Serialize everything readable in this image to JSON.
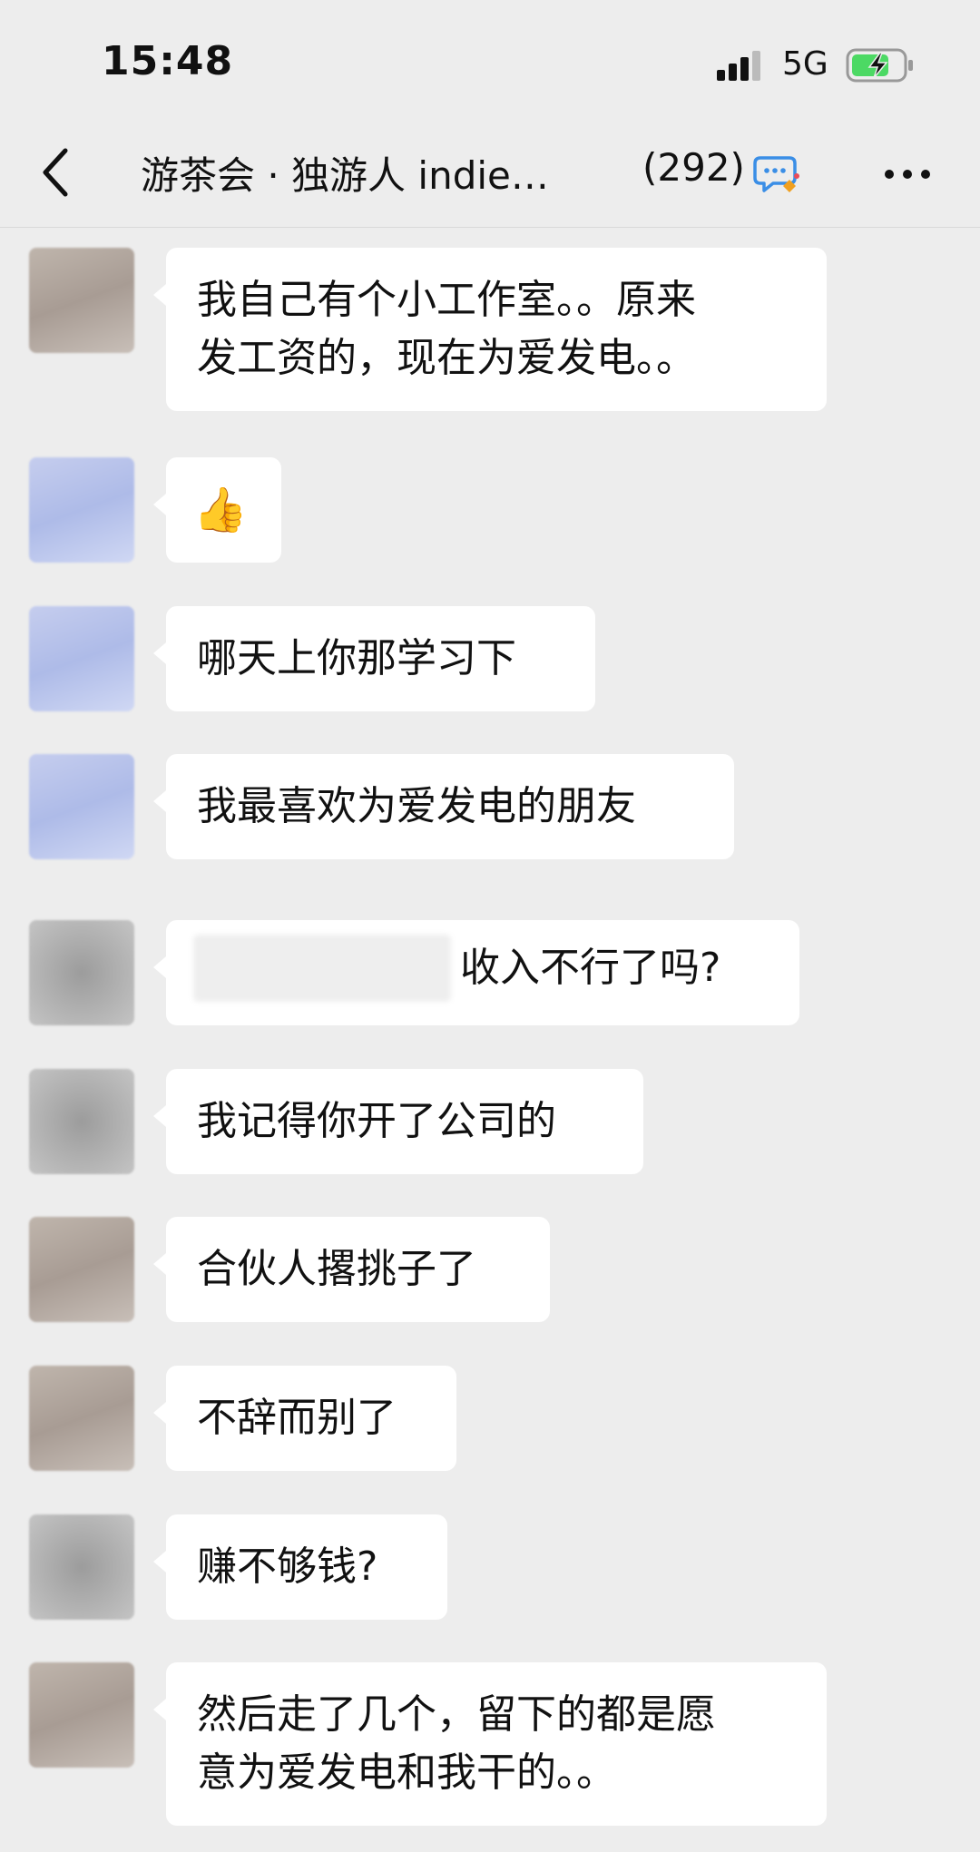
{
  "status": {
    "time": "15:48",
    "network": "5G"
  },
  "header": {
    "back_label": "<",
    "title": "游茶会 · 独游人 indie…",
    "member_count": "(292)"
  },
  "colors": {
    "background": "#ededed",
    "bubble": "#ffffff",
    "battery_green": "#4cd964"
  },
  "icons": {
    "back": "chevron-left-icon",
    "chat": "chat-bubble-icon",
    "more": "more-dots-icon",
    "thumbs_up": "thumbs-up-emoji"
  },
  "messages": [
    {
      "lines": [
        "我自己有个小工作室。。原来",
        "发工资的，现在为爱发电。。"
      ]
    },
    {
      "emoji": "👍"
    },
    {
      "lines": [
        "哪天上你那学习下"
      ]
    },
    {
      "lines": [
        "我最喜欢为爱发电的朋友"
      ]
    },
    {
      "lines": [
        "收入不行了吗?"
      ]
    },
    {
      "lines": [
        "我记得你开了公司的"
      ]
    },
    {
      "lines": [
        "合伙人撂挑子了"
      ]
    },
    {
      "lines": [
        "不辞而别了"
      ]
    },
    {
      "lines": [
        "赚不够钱?"
      ]
    },
    {
      "lines": [
        "然后走了几个，留下的都是愿",
        "意为爱发电和我干的。。"
      ]
    }
  ]
}
